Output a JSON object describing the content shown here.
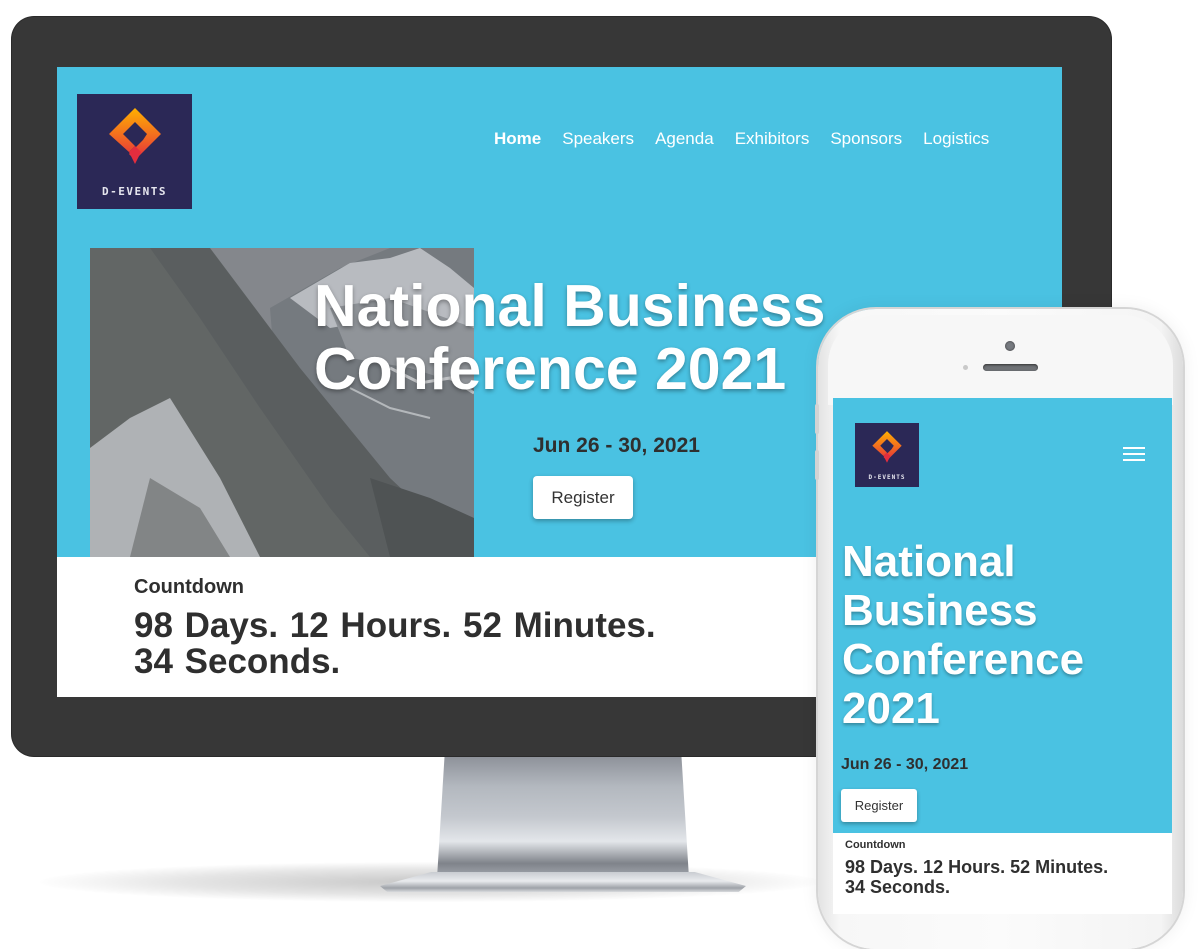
{
  "brand": {
    "logo_text": "D-EVENTS",
    "primary_color": "#4ac2e2",
    "logo_bg_color": "#2b2856",
    "logo_gradient": [
      "#ffb000",
      "#f26a21",
      "#e32d3e"
    ]
  },
  "desktop": {
    "nav": {
      "items": [
        {
          "label": "Home",
          "active": true
        },
        {
          "label": "Speakers",
          "active": false
        },
        {
          "label": "Agenda",
          "active": false
        },
        {
          "label": "Exhibitors",
          "active": false
        },
        {
          "label": "Sponsors",
          "active": false
        },
        {
          "label": "Logistics",
          "active": false
        }
      ]
    },
    "hero": {
      "title_line1": "National Business",
      "title_line2": "Conference 2021",
      "date": "Jun 26 - 30, 2021",
      "register_label": "Register",
      "image_alt": "mountain-photo"
    },
    "countdown": {
      "label": "Countdown",
      "value_line1": "98 Days. 12 Hours. 52 Minutes.",
      "value_line2": "34 Seconds."
    }
  },
  "mobile": {
    "menu_icon": "hamburger-icon",
    "hero": {
      "title_lines": [
        "National",
        "Business",
        "Conference",
        "2021"
      ],
      "date": "Jun 26 - 30, 2021",
      "register_label": "Register"
    },
    "countdown": {
      "label": "Countdown",
      "value_line1": "98 Days. 12 Hours. 52 Minutes.",
      "value_line2": "34 Seconds."
    }
  }
}
